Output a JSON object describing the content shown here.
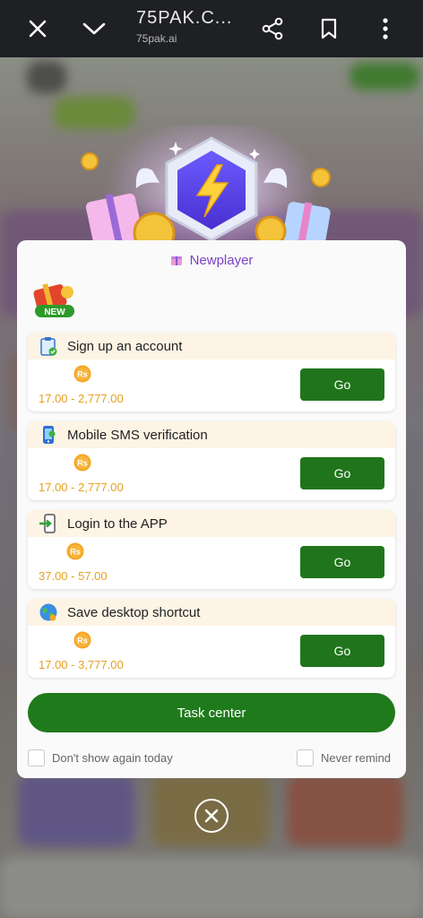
{
  "browser": {
    "title": "75PAK.C...",
    "url": "75pak.ai",
    "icons": [
      "close-icon",
      "chevron-down-icon",
      "share-icon",
      "bookmark-icon",
      "more-vert-icon"
    ]
  },
  "modal": {
    "title": "Newplayer",
    "badge_text": "NEW",
    "tasks": [
      {
        "name": "Sign up an account",
        "coin_label": "Rs",
        "range": "17.00 - 2,777.00",
        "button": "Go",
        "icon": "clipboard-check-icon"
      },
      {
        "name": "Mobile SMS verification",
        "coin_label": "Rs",
        "range": "17.00 - 2,777.00",
        "button": "Go",
        "icon": "phone-icon"
      },
      {
        "name": "Login to the APP",
        "coin_label": "Rs",
        "range": "37.00 - 57.00",
        "button": "Go",
        "icon": "login-icon"
      },
      {
        "name": "Save desktop shortcut",
        "coin_label": "Rs",
        "range": "17.00 - 3,777.00",
        "button": "Go",
        "icon": "globe-icon"
      }
    ],
    "task_center_label": "Task center",
    "dont_show_label": "Don't show again today",
    "never_remind_label": "Never remind"
  },
  "colors": {
    "accent_green": "#20751c",
    "title_purple": "#7b41c2",
    "amount_orange": "#e6a11e"
  }
}
